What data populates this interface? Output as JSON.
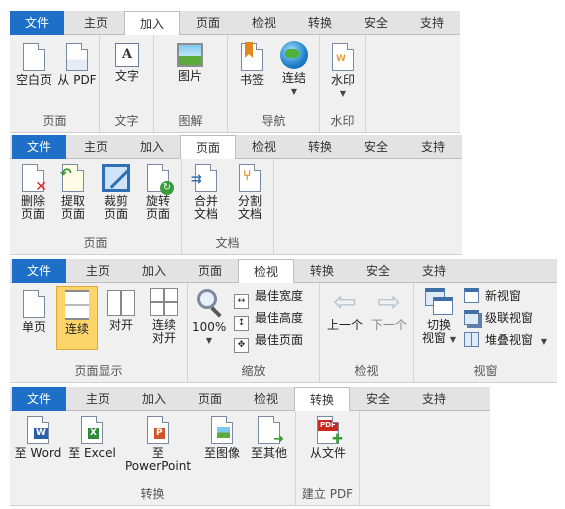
{
  "tabs": {
    "file": "文件",
    "home": "主页",
    "insert": "加入",
    "page": "页面",
    "review": "检视",
    "convert": "转换",
    "security": "安全",
    "support": "支持"
  },
  "insert_ribbon": {
    "blank_page": "空白页",
    "from_pdf": "从 PDF",
    "text": "文字",
    "image": "图片",
    "bookmark": "书签",
    "link": "连结",
    "watermark": "水印",
    "groups": {
      "page": "页面",
      "text": "文字",
      "illustration": "图解",
      "navigation": "导航",
      "watermark": "水印"
    }
  },
  "page_ribbon": {
    "delete": [
      "删除",
      "页面"
    ],
    "extract": [
      "提取",
      "页面"
    ],
    "crop": [
      "裁剪",
      "页面"
    ],
    "rotate": [
      "旋转",
      "页面"
    ],
    "merge": [
      "合并",
      "文档"
    ],
    "split": [
      "分割",
      "文档"
    ],
    "groups": {
      "page": "页面",
      "document": "文档"
    }
  },
  "review_ribbon": {
    "single": "单页",
    "continuous": "连续",
    "facing": "对开",
    "continuous_facing": [
      "连续",
      "对开"
    ],
    "zoom_value": "100%",
    "best_width": "最佳宽度",
    "best_height": "最佳高度",
    "best_page": "最佳页面",
    "prev": "上一个",
    "next": "下一个",
    "switch_window": [
      "切换",
      "视窗"
    ],
    "new_window": "新视窗",
    "cascade": "级联视窗",
    "tile": "堆叠视窗",
    "groups": {
      "page_display": "页面显示",
      "zoom": "缩放",
      "review": "检视",
      "window": "视窗"
    }
  },
  "convert_ribbon": {
    "to_word": "至 Word",
    "to_excel": "至 Excel",
    "to_powerpoint": "至 PowerPoint",
    "to_image": "至图像",
    "to_other": "至其他",
    "from_file": "从文件",
    "groups": {
      "convert": "转换",
      "create_pdf": "建立 PDF"
    }
  },
  "colors": {
    "file_tab": "#1d6fc8",
    "pressed": "#fbd46a",
    "ribbon_bg": "#f0f0f0",
    "tab_strip": "#e3e3e3"
  },
  "icons": {
    "blank_page": "blank-page-icon",
    "from_pdf": "pdf-page-icon",
    "text": "text-icon",
    "image": "image-icon",
    "bookmark": "bookmark-icon",
    "link": "globe-link-icon",
    "watermark": "watermark-icon"
  }
}
